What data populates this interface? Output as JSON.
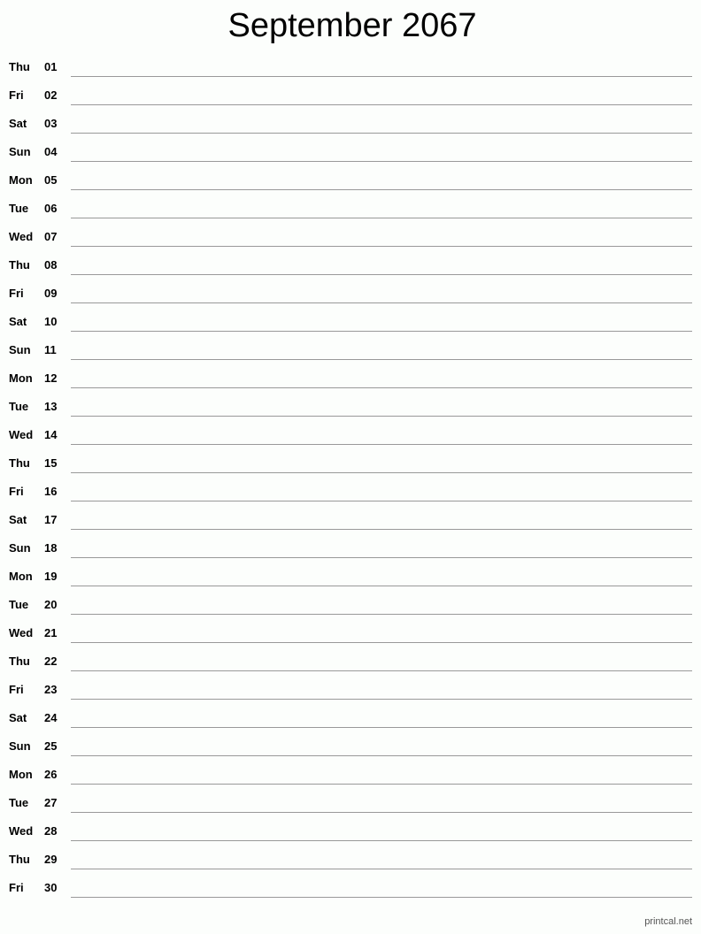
{
  "title": "September 2067",
  "days": [
    {
      "dow": "Thu",
      "num": "01"
    },
    {
      "dow": "Fri",
      "num": "02"
    },
    {
      "dow": "Sat",
      "num": "03"
    },
    {
      "dow": "Sun",
      "num": "04"
    },
    {
      "dow": "Mon",
      "num": "05"
    },
    {
      "dow": "Tue",
      "num": "06"
    },
    {
      "dow": "Wed",
      "num": "07"
    },
    {
      "dow": "Thu",
      "num": "08"
    },
    {
      "dow": "Fri",
      "num": "09"
    },
    {
      "dow": "Sat",
      "num": "10"
    },
    {
      "dow": "Sun",
      "num": "11"
    },
    {
      "dow": "Mon",
      "num": "12"
    },
    {
      "dow": "Tue",
      "num": "13"
    },
    {
      "dow": "Wed",
      "num": "14"
    },
    {
      "dow": "Thu",
      "num": "15"
    },
    {
      "dow": "Fri",
      "num": "16"
    },
    {
      "dow": "Sat",
      "num": "17"
    },
    {
      "dow": "Sun",
      "num": "18"
    },
    {
      "dow": "Mon",
      "num": "19"
    },
    {
      "dow": "Tue",
      "num": "20"
    },
    {
      "dow": "Wed",
      "num": "21"
    },
    {
      "dow": "Thu",
      "num": "22"
    },
    {
      "dow": "Fri",
      "num": "23"
    },
    {
      "dow": "Sat",
      "num": "24"
    },
    {
      "dow": "Sun",
      "num": "25"
    },
    {
      "dow": "Mon",
      "num": "26"
    },
    {
      "dow": "Tue",
      "num": "27"
    },
    {
      "dow": "Wed",
      "num": "28"
    },
    {
      "dow": "Thu",
      "num": "29"
    },
    {
      "dow": "Fri",
      "num": "30"
    }
  ],
  "footer": "printcal.net"
}
